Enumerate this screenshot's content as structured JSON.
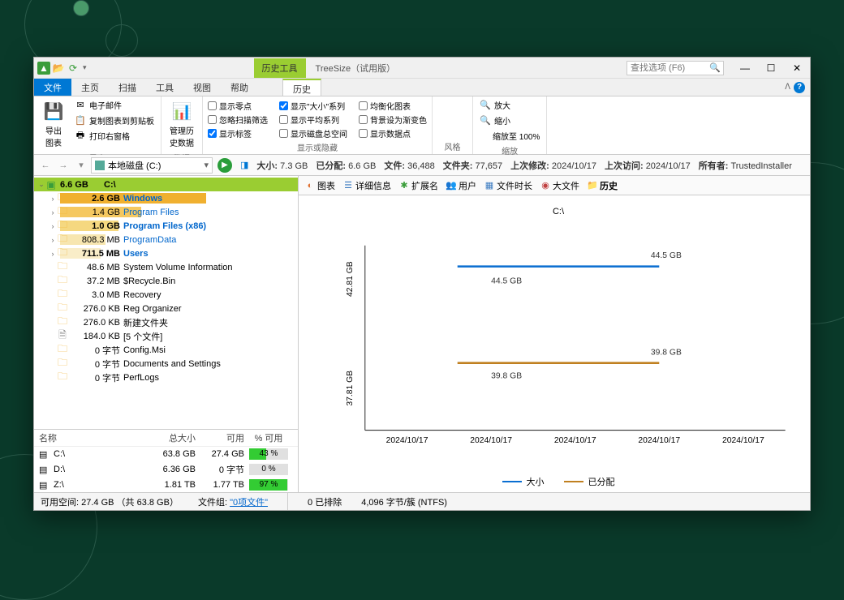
{
  "titlebar": {
    "context_label": "历史工具",
    "app_title": "TreeSize（试用版）",
    "search_placeholder": "查找选项 (F6)"
  },
  "tabs": {
    "file": "文件",
    "home": "主页",
    "scan": "扫描",
    "tools": "工具",
    "view": "视图",
    "help": "帮助",
    "history": "历史"
  },
  "ribbon": {
    "export": {
      "big": "导出\n图表",
      "email": "电子邮件",
      "clipboard": "复制图表到剪贴板",
      "print": "打印右窗格",
      "label": "导出"
    },
    "data": {
      "manage": "管理历\n史数据",
      "label": "数据"
    },
    "showhide": {
      "zero": "显示零点",
      "size_series": "显示\"大小\"系列",
      "balance": "均衡化图表",
      "skip": "忽略扫描筛选",
      "avg": "显示平均系列",
      "bg_gradient": "背景设为渐变色",
      "labels": "显示标签",
      "total": "显示磁盘总空间",
      "datapoints": "显示数据点",
      "label": "显示或隐藏"
    },
    "style": {
      "label": "风格"
    },
    "zoom": {
      "in": "放大",
      "out": "缩小",
      "reset": "缩放至 100%",
      "label": "缩放"
    }
  },
  "toolbar": {
    "path": "本地磁盘 (C:)",
    "size_label": "大小:",
    "size": "7.3 GB",
    "alloc_label": "已分配:",
    "alloc": "6.6 GB",
    "files_label": "文件:",
    "files": "36,488",
    "folders_label": "文件夹:",
    "folders": "77,657",
    "modified_label": "上次修改:",
    "modified": "2024/10/17",
    "access_label": "上次访问:",
    "access": "2024/10/17",
    "owner_label": "所有者:",
    "owner": "TrustedInstaller"
  },
  "tree": {
    "root": {
      "size": "6.6 GB",
      "name": "C:\\"
    },
    "items": [
      {
        "size": "2.6 GB",
        "name": "Windows",
        "bold": true,
        "blue": true,
        "bar": 180,
        "barColor": "#f0b030",
        "expand": true
      },
      {
        "size": "1.4 GB",
        "name": "Program Files",
        "blue": true,
        "bar": 100,
        "barColor": "#f5c860",
        "expand": true
      },
      {
        "size": "1.0 GB",
        "name": "Program Files (x86)",
        "bold": true,
        "blue": true,
        "bar": 72,
        "barColor": "#f5d880",
        "expand": true
      },
      {
        "size": "808.3 MB",
        "name": "ProgramData",
        "blue": true,
        "bar": 56,
        "barColor": "#f7e6b0",
        "expand": true
      },
      {
        "size": "711.5 MB",
        "name": "Users",
        "bold": true,
        "blue": true,
        "bar": 50,
        "barColor": "#f9edc8",
        "expand": true
      },
      {
        "size": "48.6 MB",
        "name": "System Volume Information",
        "expand": false
      },
      {
        "size": "37.2 MB",
        "name": "$Recycle.Bin",
        "expand": false
      },
      {
        "size": "3.0 MB",
        "name": "Recovery",
        "expand": false
      },
      {
        "size": "276.0 KB",
        "name": "Reg Organizer",
        "expand": false
      },
      {
        "size": "276.0 KB",
        "name": "新建文件夹",
        "expand": false
      },
      {
        "size": "184.0 KB",
        "name": "[5 个文件]",
        "file": true,
        "expand": false
      },
      {
        "size": "0 字节",
        "name": "Config.Msi",
        "expand": false
      },
      {
        "size": "0 字节",
        "name": "Documents and Settings",
        "expand": false
      },
      {
        "size": "0 字节",
        "name": "PerfLogs",
        "expand": false
      }
    ]
  },
  "drives": {
    "head": {
      "name": "名称",
      "total": "总大小",
      "free": "可用",
      "pct": "% 可用"
    },
    "rows": [
      {
        "name": "C:\\",
        "total": "63.8 GB",
        "free": "27.4 GB",
        "pct": "43 %",
        "fill": 43
      },
      {
        "name": "D:\\",
        "total": "6.36 GB",
        "free": "0 字节",
        "pct": "0 %",
        "fill": 0
      },
      {
        "name": "Z:\\",
        "total": "1.81 TB",
        "free": "1.77 TB",
        "pct": "97 %",
        "fill": 97
      }
    ]
  },
  "viewtabs": {
    "chart": "图表",
    "details": "详细信息",
    "ext": "扩展名",
    "users": "用户",
    "age": "文件时长",
    "bigfiles": "大文件",
    "history": "历史"
  },
  "chart": {
    "title": "C:\\",
    "y_upper": "42.81 GB",
    "y_lower": "37.81 GB",
    "size_label_left": "44.5 GB",
    "size_label_right": "44.5 GB",
    "alloc_label_left": "39.8 GB",
    "alloc_label_right": "39.8 GB",
    "x_ticks": [
      "2024/10/17",
      "2024/10/17",
      "2024/10/17",
      "2024/10/17",
      "2024/10/17"
    ],
    "legend_size": "大小",
    "legend_alloc": "已分配"
  },
  "chart_data": {
    "type": "line",
    "title": "C:\\",
    "categories": [
      "2024/10/17",
      "2024/10/17",
      "2024/10/17",
      "2024/10/17",
      "2024/10/17"
    ],
    "series": [
      {
        "name": "大小",
        "values": [
          44.5,
          44.5,
          44.5,
          44.5,
          44.5
        ],
        "color": "#0a6ed1"
      },
      {
        "name": "已分配",
        "values": [
          39.8,
          39.8,
          39.8,
          39.8,
          39.8
        ],
        "color": "#c08020"
      }
    ],
    "ylabel": "GB",
    "y_ticks": [
      37.81,
      42.81
    ]
  },
  "status": {
    "free": "可用空间: 27.4 GB （共 63.8 GB）",
    "filegroup_label": "文件组:",
    "filegroup_link": "\"0项文件\"",
    "excluded": "0 已排除",
    "cluster": "4,096 字节/簇 (NTFS)"
  }
}
